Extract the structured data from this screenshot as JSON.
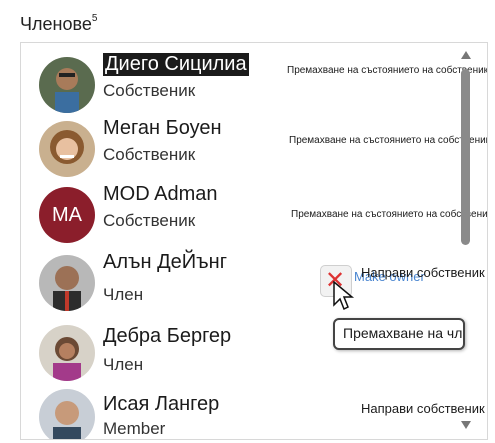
{
  "header": {
    "title": "Членове",
    "badge": "5"
  },
  "members": [
    {
      "name": "Диего Сицилиа",
      "role": "Собственик",
      "action": "Премахване на състоянието на собственик"
    },
    {
      "name": "Меган Боуен",
      "role": "Собственик",
      "action": "Премахване на състоянието на собственик"
    },
    {
      "name": "MOD Adman",
      "initials": "MA",
      "role": "Собственик",
      "action": "Премахване на състоянието на собственик"
    },
    {
      "name": "Алън ДеЙънг",
      "role": "Член",
      "action": "Направи собственик",
      "ghost_action": "Make owner"
    },
    {
      "name": "Дебра Бергер",
      "role": "Член"
    },
    {
      "name": "Исая Лангер",
      "role": "Member",
      "action": "Направи собственик"
    }
  ],
  "tooltip": {
    "text": "Премахване на член"
  },
  "remove_icon": "close-x-icon",
  "colors": {
    "remove": "#dd3333",
    "link": "#2a70c8",
    "selection": "#1b1b1b"
  }
}
